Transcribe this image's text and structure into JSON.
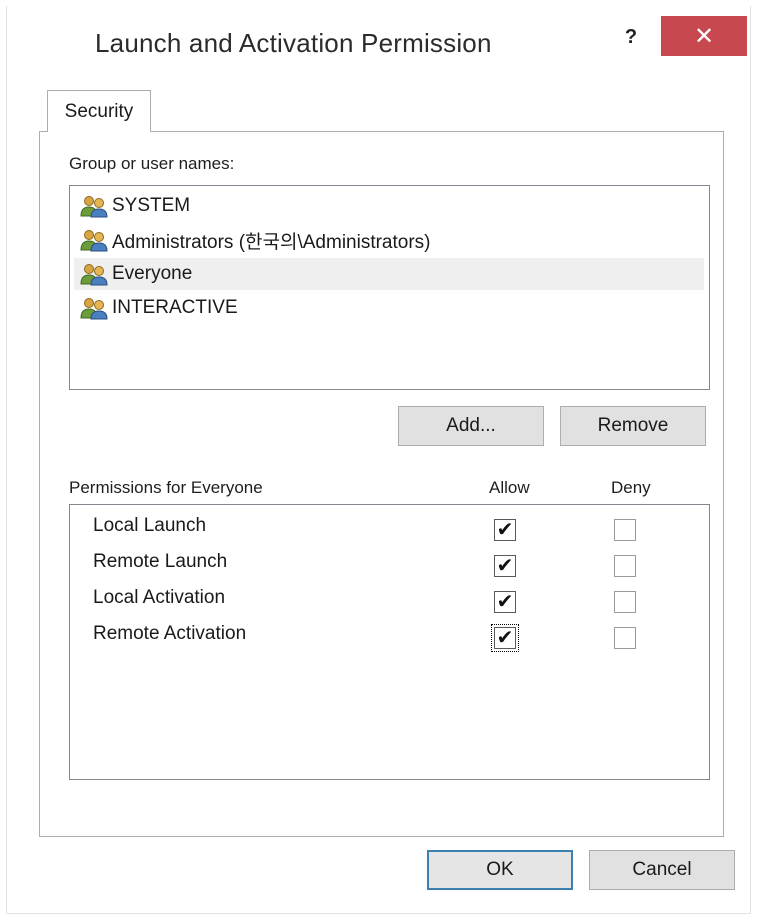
{
  "window": {
    "title": "Launch and Activation Permission",
    "help_glyph": "?",
    "close_glyph": "✕",
    "close_color": "#c7484f"
  },
  "tabs": [
    {
      "label": "Security",
      "active": true
    }
  ],
  "security": {
    "group_label": "Group or user names:",
    "users": [
      {
        "name": "SYSTEM",
        "icon": "users-group-icon",
        "selected": false
      },
      {
        "name": "Administrators (한국의\\Administrators)",
        "icon": "users-group-icon",
        "selected": false
      },
      {
        "name": "Everyone",
        "icon": "users-group-icon",
        "selected": true
      },
      {
        "name": "INTERACTIVE",
        "icon": "users-group-icon",
        "selected": false
      }
    ],
    "add_label": "Add...",
    "remove_label": "Remove",
    "permissions_label": "Permissions for Everyone",
    "allow_header": "Allow",
    "deny_header": "Deny",
    "permissions": [
      {
        "name": "Local Launch",
        "allow": true,
        "deny": false
      },
      {
        "name": "Remote Launch",
        "allow": true,
        "deny": false
      },
      {
        "name": "Local Activation",
        "allow": true,
        "deny": false
      },
      {
        "name": "Remote Activation",
        "allow": true,
        "deny": false,
        "focused": true
      }
    ]
  },
  "footer": {
    "ok_label": "OK",
    "cancel_label": "Cancel"
  }
}
